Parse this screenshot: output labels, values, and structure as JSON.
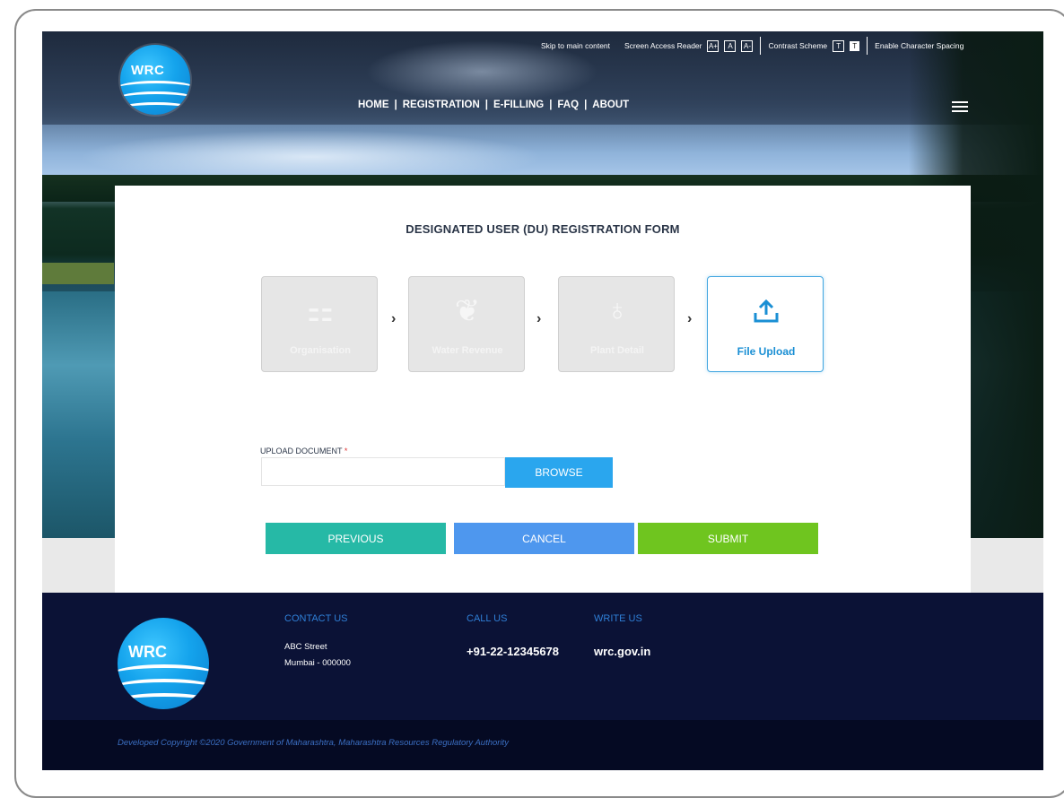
{
  "header": {
    "logo_text": "WRC",
    "accessibility": {
      "skip": "Skip to main content",
      "screen_reader": "Screen Access Reader",
      "font_buttons": [
        "A+",
        "A",
        "A-"
      ],
      "contrast": "Contrast Scheme",
      "contrast_buttons": [
        "T",
        "T"
      ],
      "char_spacing": "Enable Character Spacing"
    },
    "nav": [
      "HOME",
      "REGISTRATION",
      "E-FILLING",
      "FAQ",
      "ABOUT"
    ],
    "nav_separator": "|"
  },
  "form": {
    "title": "DESIGNATED USER (DU) REGISTRATION FORM",
    "steps": [
      {
        "label": "Organisation",
        "icon": "org-chart-icon",
        "glyph": "⚏",
        "active": false
      },
      {
        "label": "Water Revenue",
        "icon": "plant-icon",
        "glyph": "❦",
        "active": false
      },
      {
        "label": "Plant Detail",
        "icon": "tree-icon",
        "glyph": "♁",
        "active": false
      },
      {
        "label": "File Upload",
        "icon": "upload-icon",
        "glyph": "⇪",
        "active": true
      }
    ],
    "step_arrow": "›",
    "upload_label": "UPLOAD DOCUMENT",
    "required_mark": "*",
    "upload_value": "",
    "browse_label": "BROWSE",
    "buttons": {
      "previous": "PREVIOUS",
      "cancel": "CANCEL",
      "submit": "SUBMIT"
    }
  },
  "footer": {
    "logo_text": "WRC",
    "contact_heading": "CONTACT US",
    "contact_line1": "ABC Street",
    "contact_line2": "Mumbai - 000000",
    "call_heading": "CALL US",
    "phone": "+91-22-12345678",
    "write_heading": "WRITE US",
    "website": "wrc.gov.in",
    "copyright": "Developed Copyright ©2020 Government of Maharashtra, Maharashtra Resources Regulatory Authority"
  },
  "colors": {
    "previous": "#26b9a6",
    "cancel": "#4e97ee",
    "submit": "#6fc51f",
    "browse": "#2aa6ee",
    "footer": "#0b1236"
  }
}
